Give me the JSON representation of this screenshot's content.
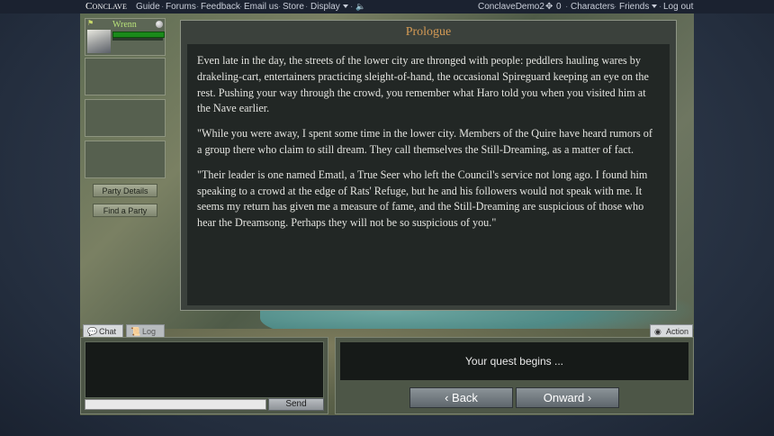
{
  "nav": {
    "logo": "Conclave",
    "guide": "Guide",
    "forums": "Forums",
    "feedback": "Feedback",
    "email": "Email us",
    "store": "Store",
    "display": "Display",
    "username": "ConclaveDemo2",
    "gem_count": "0",
    "characters": "Characters",
    "friends": "Friends",
    "logout": "Log out"
  },
  "party": {
    "member_name": "Wrenn",
    "details_button": "Party Details",
    "find_button": "Find a Party"
  },
  "story": {
    "title": "Prologue",
    "paragraphs": [
      "Even late in the day, the streets of the lower city are thronged with people: peddlers hauling wares by drakeling-cart, entertainers practicing sleight-of-hand, the occasional Spireguard keeping an eye on the rest. Pushing your way through the crowd, you remember what Haro told you when you visited him at the Nave earlier.",
      "\"While you were away, I spent some time in the lower city. Members of the Quire have heard rumors of a group there who claim to still dream. They call themselves the Still-Dreaming, as a matter of fact.",
      "\"Their leader is one named Ematl, a True Seer who left the Council's service not long ago. I found him speaking to a crowd at the edge of Rats' Refuge, but he and his followers would not speak with me. It seems my return has given me a measure of fame, and the Still-Dreaming are suspicious of those who hear the Dreamsong. Perhaps they will not be so suspicious of you.\""
    ]
  },
  "tabs": {
    "chat": "Chat",
    "log": "Log",
    "action": "Action"
  },
  "chat": {
    "send": "Send"
  },
  "action": {
    "message": "Your quest begins ...",
    "back": "‹ Back",
    "onward": "Onward ›"
  }
}
